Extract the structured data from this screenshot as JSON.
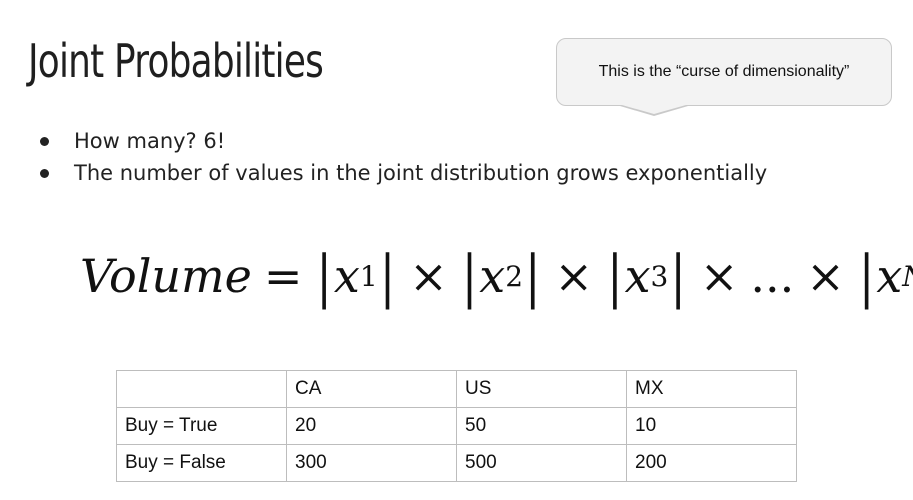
{
  "slide": {
    "title": "Joint Probabilities",
    "callout": "This is the “curse of dimensionality”",
    "bullets": [
      "How many? 6!",
      "The number of values in the joint distribution grows exponentially"
    ],
    "formula": {
      "lhs": "Volume",
      "equals": "=",
      "terms": [
        {
          "var": "x",
          "sub": "1"
        },
        {
          "var": "x",
          "sub": "2"
        },
        {
          "var": "x",
          "sub": "3"
        }
      ],
      "ellipsis": "...",
      "last": {
        "var": "x",
        "sub": "N"
      },
      "times": "×",
      "bar": "|"
    },
    "table": {
      "header": [
        "",
        "CA",
        "US",
        "MX"
      ],
      "rows": [
        [
          "Buy = True",
          "20",
          "50",
          "10"
        ],
        [
          "Buy = False",
          "300",
          "500",
          "200"
        ]
      ]
    }
  }
}
